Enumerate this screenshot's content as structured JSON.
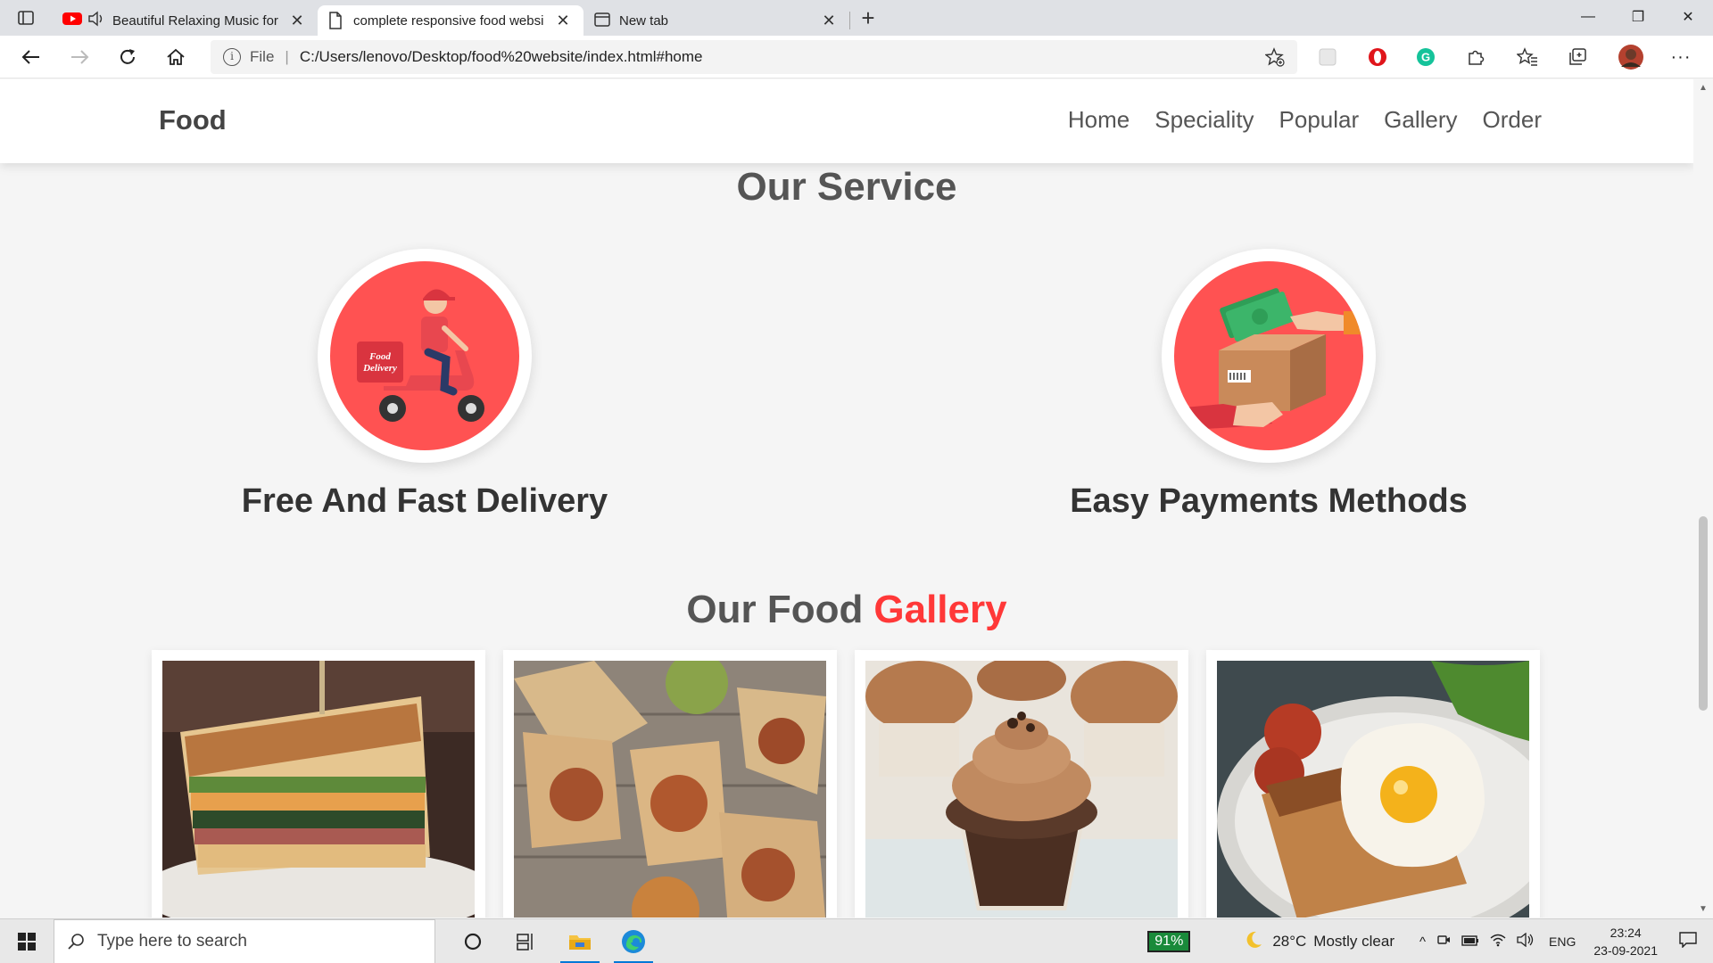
{
  "browser": {
    "tabs": [
      {
        "label": "Beautiful Relaxing Music for",
        "icon": "youtube-icon",
        "playing": true,
        "active": false
      },
      {
        "label": "complete responsive food websi",
        "icon": "page-icon",
        "active": true
      },
      {
        "label": "New tab",
        "icon": "newtab-icon",
        "active": false
      }
    ],
    "address": {
      "scheme_label": "File",
      "url": "C:/Users/lenovo/Desktop/food%20website/index.html#home"
    }
  },
  "site": {
    "logo": "Food",
    "nav": [
      "Home",
      "Speciality",
      "Popular",
      "Gallery",
      "Order"
    ],
    "service": {
      "title": "Our Service",
      "items": [
        {
          "label": "Free And Fast Delivery",
          "icon": "delivery-scooter-icon"
        },
        {
          "label": "Easy Payments Methods",
          "icon": "payment-exchange-icon"
        }
      ]
    },
    "gallery": {
      "title_main": "Our Food",
      "title_accent": "Gallery",
      "images": [
        "sandwich-image",
        "wraps-image",
        "cupcake-image",
        "egg-toast-image"
      ]
    }
  },
  "taskbar": {
    "search_placeholder": "Type here to search",
    "battery": "91%",
    "temperature": "28°C",
    "weather": "Mostly clear",
    "language": "ENG",
    "time": "23:24",
    "date": "23-09-2021"
  },
  "colors": {
    "accent": "#ff3838",
    "circle": "#ff5252"
  }
}
